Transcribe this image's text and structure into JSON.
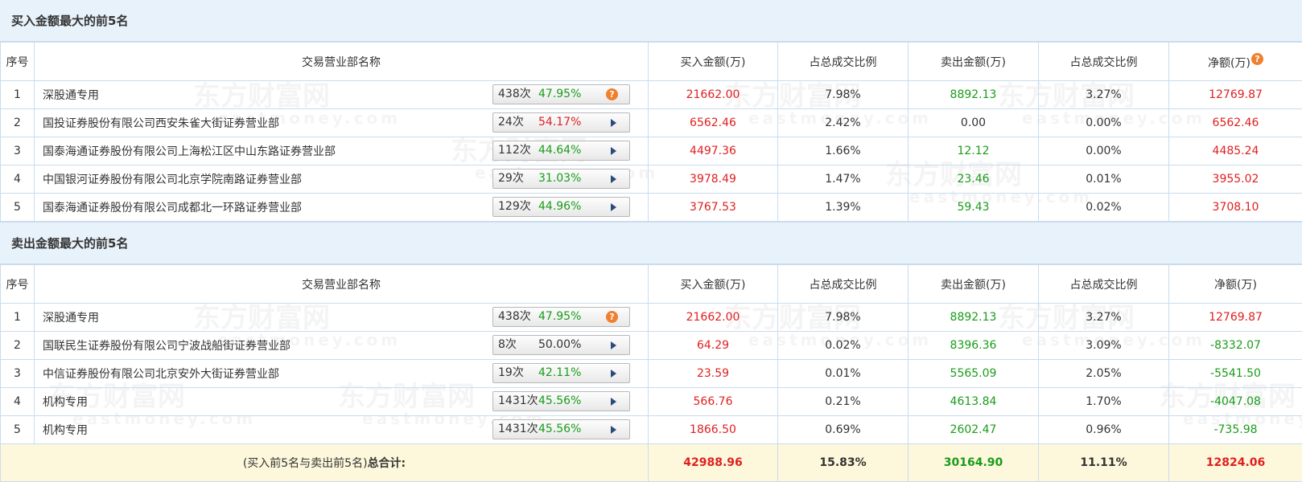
{
  "watermark": {
    "title": "东方财富网",
    "sub": "eastmoney.com"
  },
  "columns": {
    "seq": "序号",
    "name": "交易营业部名称",
    "buy": "买入金额(万)",
    "buy_ratio": "占总成交比例",
    "sell": "卖出金额(万)",
    "sell_ratio": "占总成交比例",
    "net": "净额(万)"
  },
  "help_glyph": "?",
  "buy_section": {
    "title": "买入金额最大的前5名",
    "rows": [
      {
        "seq": "1",
        "name": "深股通专用",
        "times": "438次",
        "win": "47.95%",
        "buy": "21662.00",
        "buy_ratio": "7.98%",
        "sell": "8892.13",
        "sell_ratio": "3.27%",
        "net": "12769.87"
      },
      {
        "seq": "2",
        "name": "国投证券股份有限公司西安朱雀大街证券营业部",
        "times": "24次",
        "win": "54.17%",
        "buy": "6562.46",
        "buy_ratio": "2.42%",
        "sell": "0.00",
        "sell_ratio": "0.00%",
        "net": "6562.46"
      },
      {
        "seq": "3",
        "name": "国泰海通证券股份有限公司上海松江区中山东路证券营业部",
        "times": "112次",
        "win": "44.64%",
        "buy": "4497.36",
        "buy_ratio": "1.66%",
        "sell": "12.12",
        "sell_ratio": "0.00%",
        "net": "4485.24"
      },
      {
        "seq": "4",
        "name": "中国银河证券股份有限公司北京学院南路证券营业部",
        "times": "29次",
        "win": "31.03%",
        "buy": "3978.49",
        "buy_ratio": "1.47%",
        "sell": "23.46",
        "sell_ratio": "0.01%",
        "net": "3955.02"
      },
      {
        "seq": "5",
        "name": "国泰海通证券股份有限公司成都北一环路证券营业部",
        "times": "129次",
        "win": "44.96%",
        "buy": "3767.53",
        "buy_ratio": "1.39%",
        "sell": "59.43",
        "sell_ratio": "0.02%",
        "net": "3708.10"
      }
    ]
  },
  "sell_section": {
    "title": "卖出金额最大的前5名",
    "rows": [
      {
        "seq": "1",
        "name": "深股通专用",
        "times": "438次",
        "win": "47.95%",
        "buy": "21662.00",
        "buy_ratio": "7.98%",
        "sell": "8892.13",
        "sell_ratio": "3.27%",
        "net": "12769.87"
      },
      {
        "seq": "2",
        "name": "国联民生证券股份有限公司宁波战船街证券营业部",
        "times": "8次",
        "win": "50.00%",
        "buy": "64.29",
        "buy_ratio": "0.02%",
        "sell": "8396.36",
        "sell_ratio": "3.09%",
        "net": "-8332.07"
      },
      {
        "seq": "3",
        "name": "中信证券股份有限公司北京安外大街证券营业部",
        "times": "19次",
        "win": "42.11%",
        "buy": "23.59",
        "buy_ratio": "0.01%",
        "sell": "5565.09",
        "sell_ratio": "2.05%",
        "net": "-5541.50"
      },
      {
        "seq": "4",
        "name": "机构专用",
        "times": "1431次",
        "win": "45.56%",
        "buy": "566.76",
        "buy_ratio": "0.21%",
        "sell": "4613.84",
        "sell_ratio": "1.70%",
        "net": "-4047.08"
      },
      {
        "seq": "5",
        "name": "机构专用",
        "times": "1431次",
        "win": "45.56%",
        "buy": "1866.50",
        "buy_ratio": "0.69%",
        "sell": "2602.47",
        "sell_ratio": "0.96%",
        "net": "-735.98"
      }
    ]
  },
  "total": {
    "label_prefix": "(买入前5名与卖出前5名)",
    "label_bold": "总合计:",
    "buy": "42988.96",
    "buy_ratio": "15.83%",
    "sell": "30164.90",
    "sell_ratio": "11.11%",
    "net": "12824.06"
  },
  "colors": {
    "red": "#e02020",
    "green": "#1a9c1a",
    "header_bg": "#e8f2fb",
    "total_bg": "#fdf8dc",
    "border": "#c9dcee",
    "help": "#f07f2e"
  }
}
